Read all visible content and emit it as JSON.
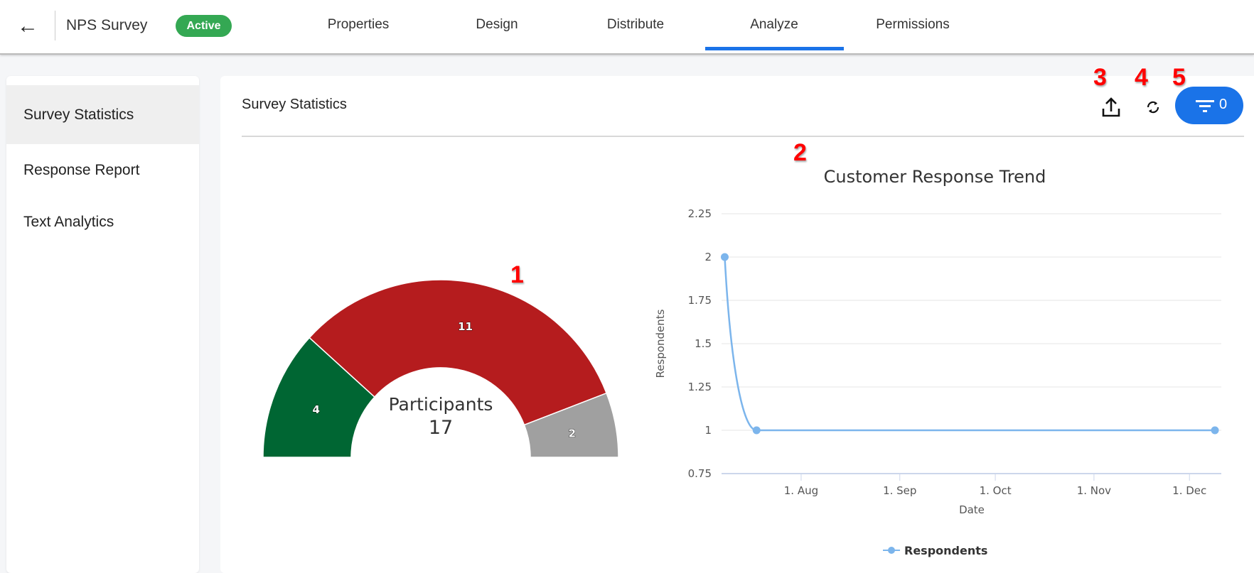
{
  "header": {
    "back_icon": "arrow-left-icon",
    "title": "NPS Survey",
    "status": "Active",
    "status_color": "#34a853",
    "tabs": [
      {
        "label": "Properties"
      },
      {
        "label": "Design"
      },
      {
        "label": "Distribute"
      },
      {
        "label": "Analyze",
        "active": true
      },
      {
        "label": "Permissions"
      }
    ],
    "accent": "#1a73e8"
  },
  "sidebar": {
    "items": [
      {
        "label": "Survey Statistics",
        "selected": true
      },
      {
        "label": "Response Report"
      },
      {
        "label": "Text Analytics"
      }
    ]
  },
  "main": {
    "title": "Survey Statistics",
    "toolbar": {
      "export_icon": "upload-icon",
      "refresh_icon": "refresh-icon",
      "filter_icon": "filter-icon",
      "filter_count": "0"
    }
  },
  "annotations": [
    "1",
    "2",
    "3",
    "4",
    "5"
  ],
  "chart_data": [
    {
      "type": "pie",
      "variant": "semicircle-gauge",
      "center_label": "Participants",
      "center_value": "17",
      "slices": [
        {
          "value": 4,
          "color": "#006633"
        },
        {
          "value": 11,
          "color": "#b51c1e"
        },
        {
          "value": 2,
          "color": "#a0a0a0"
        }
      ]
    },
    {
      "type": "line",
      "title": "Customer Response Trend",
      "xlabel": "Date",
      "ylabel": "Respondents",
      "ylim": [
        0.75,
        2.25
      ],
      "yticks": [
        "0.75",
        "1",
        "1.25",
        "1.5",
        "1.75",
        "2",
        "2.25"
      ],
      "xticks": [
        "1. Aug",
        "1. Sep",
        "1. Oct",
        "1. Nov",
        "1. Dec"
      ],
      "grid": true,
      "legend": "bottom",
      "series": [
        {
          "name": "Respondents",
          "color": "#7cb5ec",
          "x": [
            "Jul 8",
            "Jul 18",
            "Dec 9"
          ],
          "y": [
            2,
            1,
            1
          ]
        }
      ]
    }
  ]
}
